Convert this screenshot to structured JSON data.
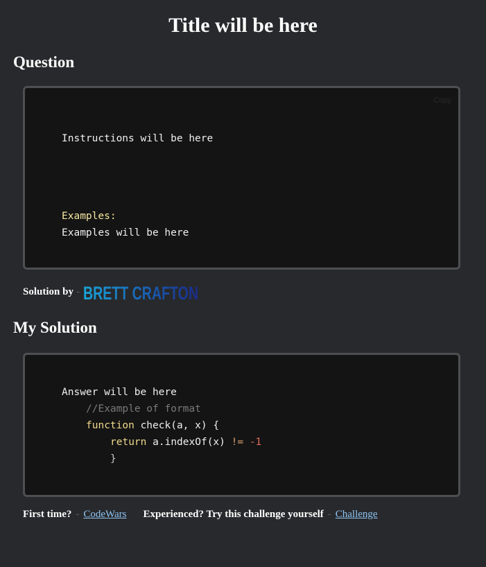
{
  "page": {
    "title": "Title will be here"
  },
  "question": {
    "heading": "Question",
    "copy_label": "Copy",
    "instructions": "Instructions will be here",
    "examples_label": "Examples:",
    "examples": "Examples will be here"
  },
  "byline": {
    "label": "Solution by",
    "separator": "-",
    "logo_text": "BRETT CRAFTON"
  },
  "solution": {
    "heading": "My Solution",
    "lines": {
      "answer": "Answer will be here",
      "comment": "//Example of format",
      "fn_keyword": "function",
      "fn_signature": "check(a, x) {",
      "return_keyword": "return",
      "return_expr": "a.indexOf(x)",
      "operator": "!=",
      "value": "-1",
      "close_brace": "}"
    }
  },
  "footer": {
    "first_time_label": "First time?",
    "first_time_link": "CodeWars",
    "experienced_label": "Experienced? Try this challenge yourself",
    "experienced_link": "Challenge",
    "separator": "-"
  },
  "colors": {
    "background": "#28292c",
    "code_background": "#141414",
    "code_border": "#4e4f52",
    "link": "#8ec5f4",
    "keyword": "#f2d98c",
    "comment": "#7a7a7a",
    "number": "#e06c5a"
  }
}
